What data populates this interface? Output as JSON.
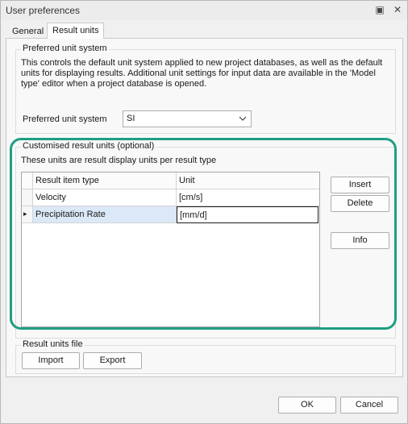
{
  "window": {
    "title": "User preferences",
    "pin_glyph": "▣",
    "close_glyph": "✕"
  },
  "tabs": [
    {
      "label": "General",
      "active": false
    },
    {
      "label": "Result units",
      "active": true
    }
  ],
  "preferred": {
    "group_title": "Preferred unit system",
    "description": "This controls the default unit system applied to new project databases, as well as the default units for displaying results. Additional unit settings for input data are available in the 'Model type' editor when a project database is opened.",
    "field_label": "Preferred unit system",
    "selected_value": "SI"
  },
  "custom": {
    "group_title": "Customised result units (optional)",
    "description": "These units are result display units per result type",
    "columns": [
      "Result item type",
      "Unit"
    ],
    "rows": [
      {
        "type": "Velocity",
        "unit": "[cm/s]",
        "current": false
      },
      {
        "type": "Precipitation Rate",
        "unit": "[mm/d]",
        "current": true
      }
    ],
    "row_pointer_glyph": "▸",
    "buttons": {
      "insert": "Insert",
      "delete": "Delete",
      "info": "Info"
    }
  },
  "result_file": {
    "group_title": "Result units file",
    "import_label": "Import",
    "export_label": "Export"
  },
  "footer": {
    "ok_label": "OK",
    "cancel_label": "Cancel"
  },
  "colors": {
    "highlight_ring": "#1f9e83",
    "selected_cell": "#dbe8f7"
  }
}
